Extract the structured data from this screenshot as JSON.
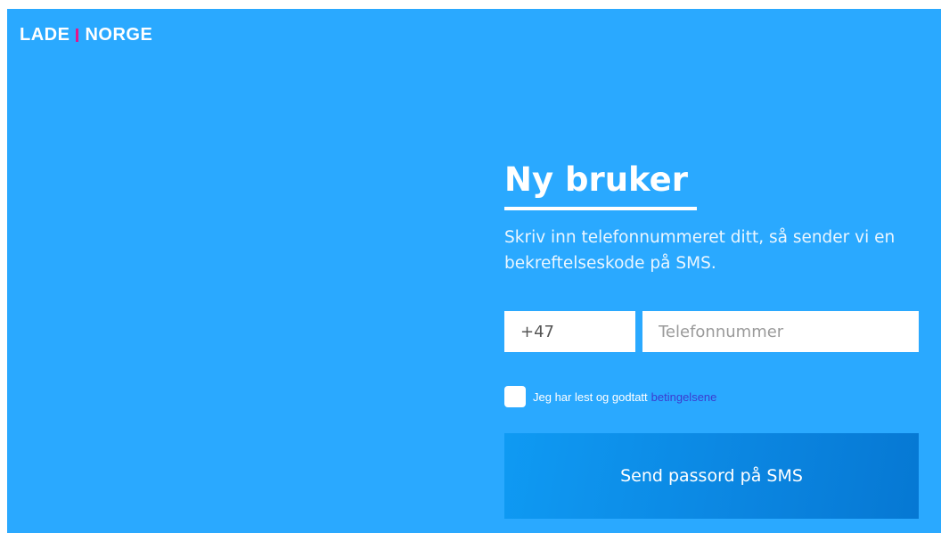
{
  "brand": {
    "left": "LADE",
    "right": "NORGE",
    "separator_color": "#e4168a"
  },
  "form": {
    "title": "Ny bruker",
    "intro": "Skriv inn telefonnummeret ditt, så sender vi en bekreftelseskode på SMS.",
    "country_code": "+47",
    "phone_placeholder": "Telefonnummer",
    "terms_text": "Jeg har lest og godtatt",
    "terms_link": "betingelsene",
    "terms_checked": false,
    "submit_label": "Send passord på SMS"
  },
  "colors": {
    "background": "#2aa9ff",
    "button": "#0b85e0",
    "link": "#3c3ccf"
  }
}
